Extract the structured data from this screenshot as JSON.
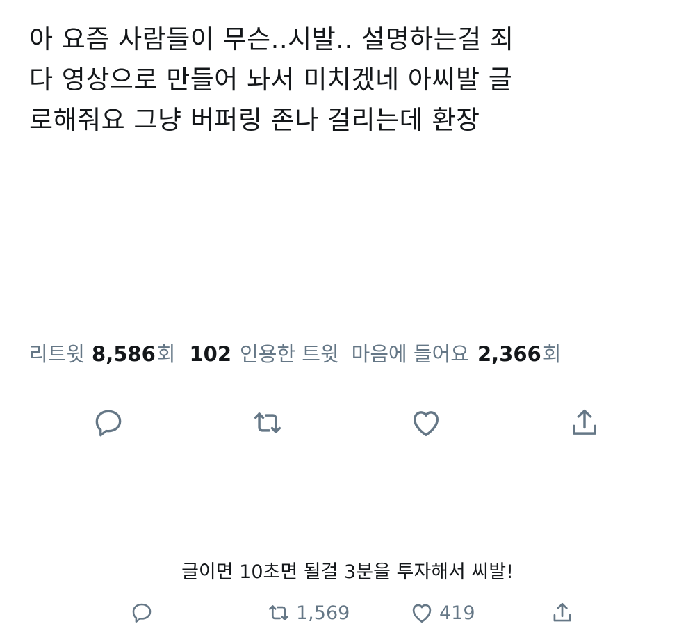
{
  "tweet": {
    "line1": "아 요즘 사람들이 무슨..시발.. 설명하는걸 죄",
    "line2": "다 영상으로 만들어 놔서 미치겠네 아씨발 글",
    "line3": "로해줘요 그냥 버퍼링 존나 걸리는데 환장"
  },
  "stats": {
    "retweet_label": "리트윗",
    "retweet_count": "8,586",
    "retweet_suffix": "회",
    "quote_count": "102",
    "quote_label": "인용한 트윗",
    "like_label": "마음에 들어요",
    "like_count": "2,366",
    "like_suffix": "회"
  },
  "actions": {
    "icons": [
      "reply-icon",
      "retweet-icon",
      "heart-icon",
      "share-icon"
    ],
    "icon_color": "#657786"
  },
  "reply": {
    "text": "글이면 10초면 될걸 3분을 투자해서 씨발!",
    "retweet_count": "1,569",
    "like_count": "419"
  },
  "colors": {
    "text": "#14171a",
    "secondary": "#657786",
    "divider": "#e1e8ed"
  }
}
